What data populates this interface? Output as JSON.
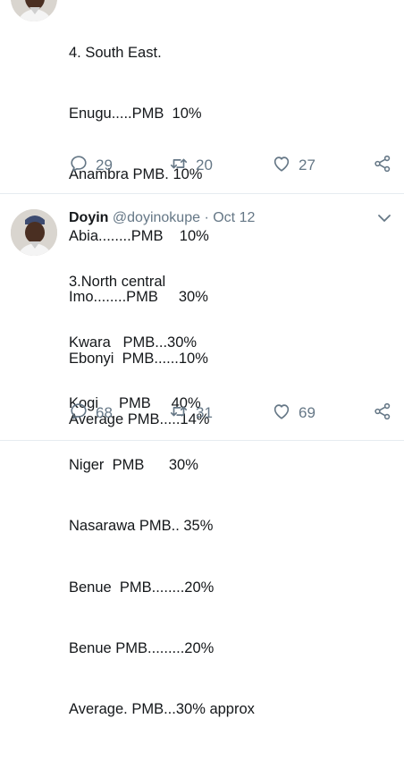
{
  "tweet1": {
    "lines": [
      "4. South East.",
      "Enugu.....PMB  10%",
      "Anambra PMB. 10%",
      "Abia........PMB    10%",
      "Imo........PMB     30%",
      "Ebonyi  PMB......10%",
      "Average PMB.....14%"
    ],
    "reply_count": "29",
    "retweet_count": "20",
    "like_count": "27"
  },
  "tweet2": {
    "author_name": "Doyin",
    "handle": "@doyinokupe",
    "separator": "·",
    "date": "Oct 12",
    "lines": [
      "3.North central",
      "Kwara   PMB...30%",
      "Kogi     PMB     40%",
      "Niger  PMB      30%",
      "Nasarawa PMB.. 35%",
      "Benue  PMB........20%",
      "Benue PMB.........20%",
      "Average. PMB...30% approx"
    ],
    "reply_count": "68",
    "retweet_count": "31",
    "like_count": "69"
  },
  "icons": {
    "reply": "reply-icon",
    "retweet": "retweet-icon",
    "like": "heart-icon",
    "share": "share-icon",
    "caret": "chevron-down-icon"
  },
  "colors": {
    "text": "#14171a",
    "muted": "#657786",
    "divider": "#e6ecf0"
  }
}
